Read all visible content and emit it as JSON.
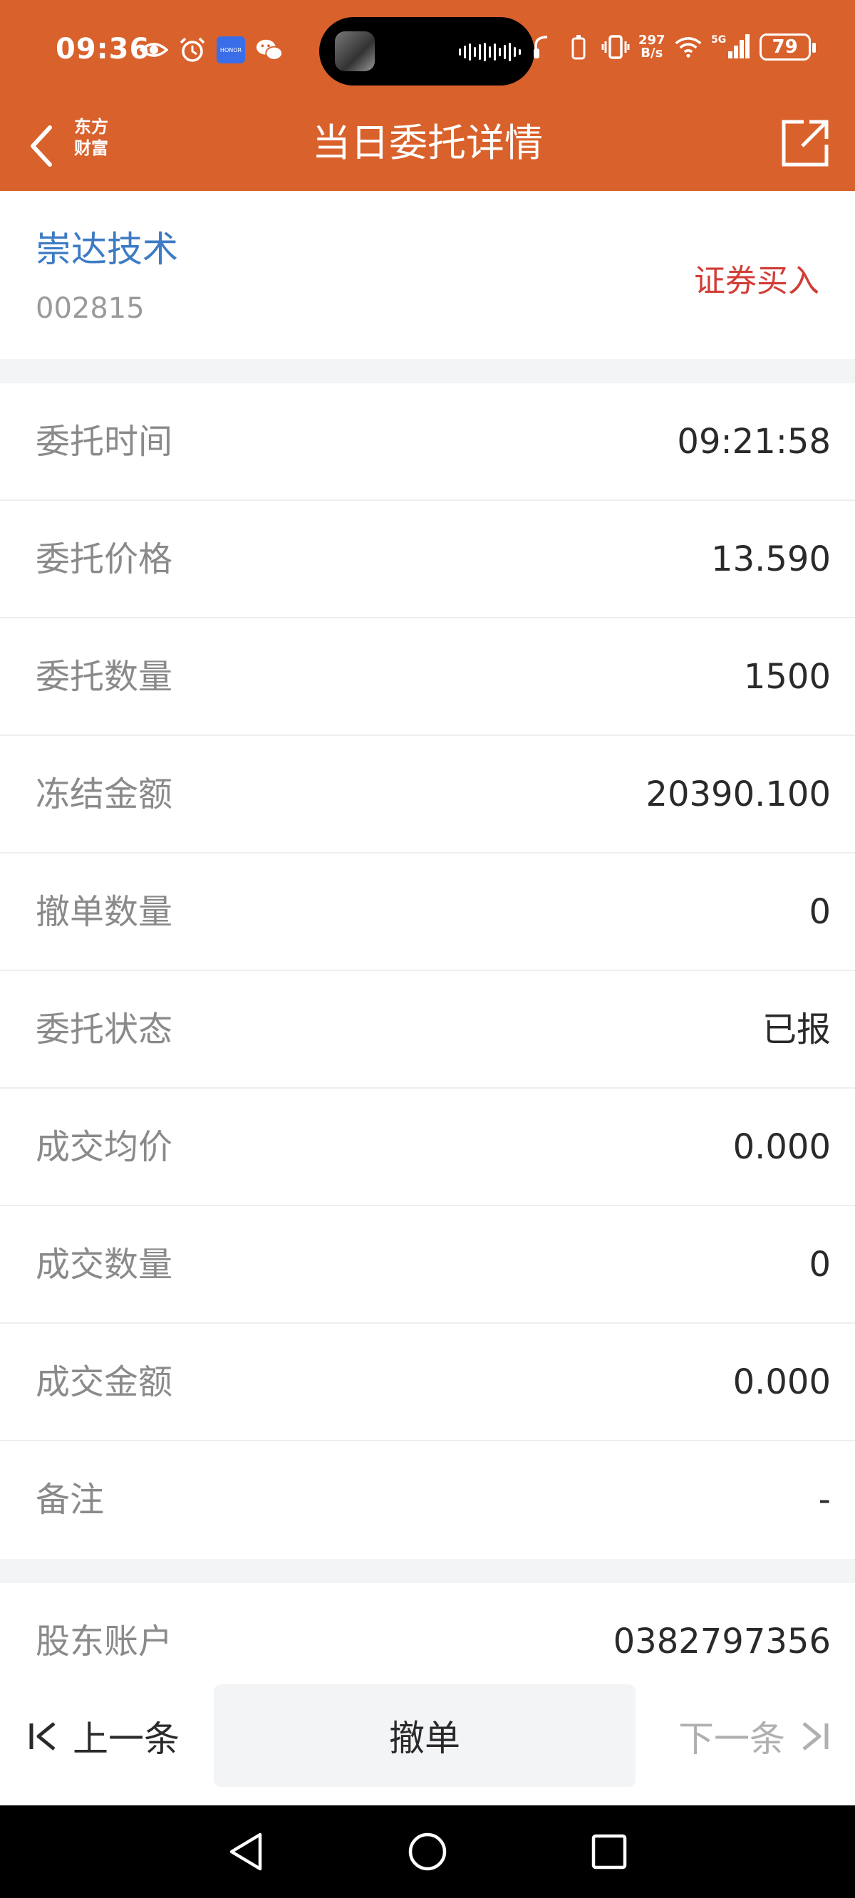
{
  "status_bar": {
    "time": "09:36",
    "net_speed_top": "297",
    "net_speed_bottom": "B/s",
    "network": "5G",
    "battery": "79"
  },
  "header": {
    "logo_line1": "东方",
    "logo_line2": "财富",
    "title": "当日委托详情",
    "back_icon": "chevron-left-icon",
    "share_icon": "share-icon"
  },
  "stock": {
    "name": "崇达技术",
    "code": "002815",
    "trade_type": "证券买入"
  },
  "details": [
    {
      "label": "委托时间",
      "value": "09:21:58"
    },
    {
      "label": "委托价格",
      "value": "13.590"
    },
    {
      "label": "委托数量",
      "value": "1500"
    },
    {
      "label": "冻结金额",
      "value": "20390.100"
    },
    {
      "label": "撤单数量",
      "value": "0"
    },
    {
      "label": "委托状态",
      "value": "已报"
    },
    {
      "label": "成交均价",
      "value": "0.000"
    },
    {
      "label": "成交数量",
      "value": "0"
    },
    {
      "label": "成交金额",
      "value": "0.000"
    },
    {
      "label": "备注",
      "value": "-"
    }
  ],
  "account": {
    "label": "股东账户",
    "value": "0382797356"
  },
  "actions": {
    "prev_label": "上一条",
    "cancel_label": "撤单",
    "next_label": "下一条"
  },
  "colors": {
    "brand": "#d9612c",
    "stock_name": "#3d7bc4",
    "trade_type": "#d23d36"
  }
}
